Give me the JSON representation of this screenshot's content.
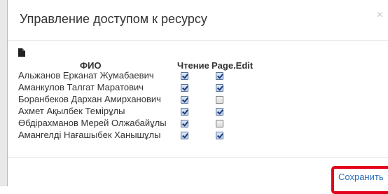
{
  "dialog": {
    "title": "Управление доступом к ресурсу",
    "close_glyph": "×"
  },
  "table": {
    "headers": {
      "name": "ФИО",
      "read": "Чтение",
      "edit": "Page.Edit"
    },
    "rows": [
      {
        "name": "Альжанов Ерканат Жумабаевич",
        "read": true,
        "edit": true
      },
      {
        "name": "Аманкулов Талгат Маратович",
        "read": true,
        "edit": true
      },
      {
        "name": "Боранбеков Дархан Амирханович",
        "read": true,
        "edit": false
      },
      {
        "name": "Ахмет Ақылбек Темірұлы",
        "read": true,
        "edit": true
      },
      {
        "name": "Өбдірахманов Мерей Олжабайұлы",
        "read": true,
        "edit": false
      },
      {
        "name": "Амангелді Нағашыбек Ханышұлы",
        "read": true,
        "edit": true
      }
    ]
  },
  "footer": {
    "save_label": "Сохранить",
    "highlight_color": "#e2001a",
    "link_color": "#2a6ebb"
  },
  "icons": {
    "file": "file-icon",
    "close": "close-icon"
  }
}
